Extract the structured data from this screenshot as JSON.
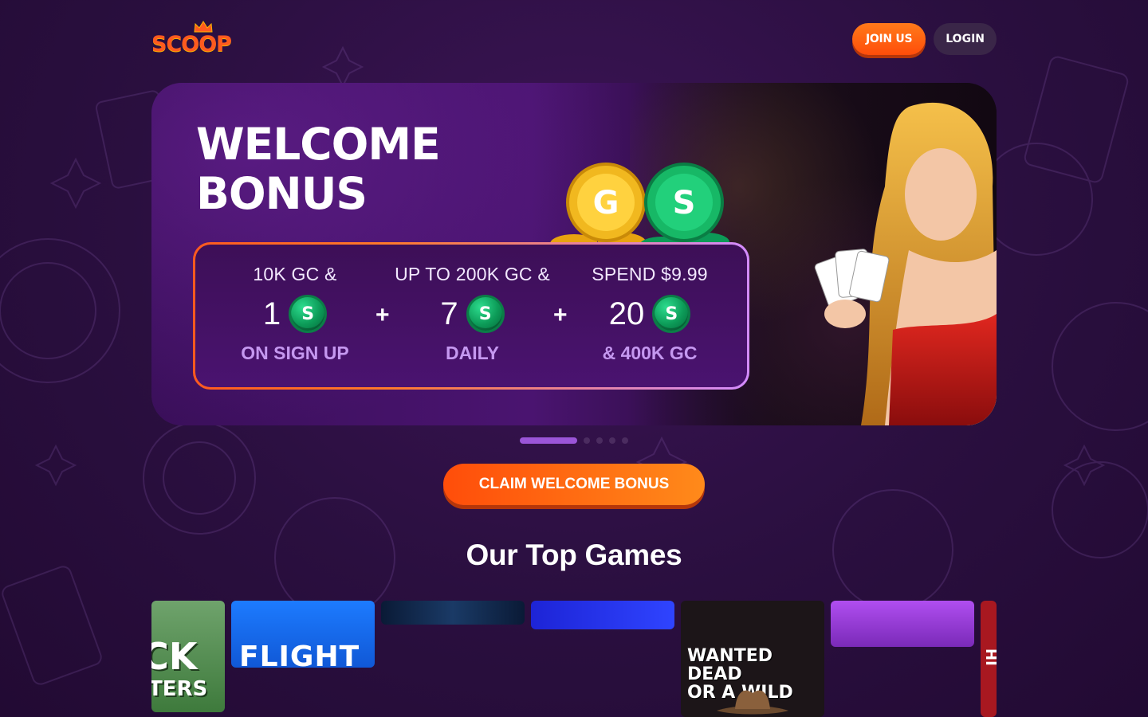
{
  "brand": {
    "logo_text": "SCOOP",
    "accent": "#ff5a1f"
  },
  "header": {
    "join_label": "JOIN US",
    "login_label": "LOGIN"
  },
  "hero": {
    "title_line1": "WELCOME",
    "title_line2": "BONUS",
    "coin_gold_letter": "G",
    "coin_green_letter": "S",
    "columns": [
      {
        "top": "10K GC &",
        "amount": "1",
        "coin": "S",
        "bottom": "ON SIGN UP"
      },
      {
        "top": "UP TO 200K GC &",
        "amount": "7",
        "coin": "S",
        "bottom": "DAILY"
      },
      {
        "top": "SPEND $9.99",
        "amount": "20",
        "coin": "S",
        "bottom": "& 400K GC"
      }
    ],
    "plus_symbol": "+"
  },
  "carousel": {
    "active_index": 0,
    "count": 5
  },
  "cta": {
    "label": "CLAIM WELCOME BONUS"
  },
  "top_games": {
    "title": "Our Top Games",
    "tiles": [
      {
        "line1": "CK",
        "line2": "TERS"
      },
      {
        "line1": "FLIGHT"
      },
      {
        "line1": ""
      },
      {
        "line1": ""
      },
      {
        "line1": "WANTED DEAD",
        "line2": "OR A WILD"
      },
      {
        "line1": ""
      },
      {
        "line1": "HI"
      }
    ]
  }
}
